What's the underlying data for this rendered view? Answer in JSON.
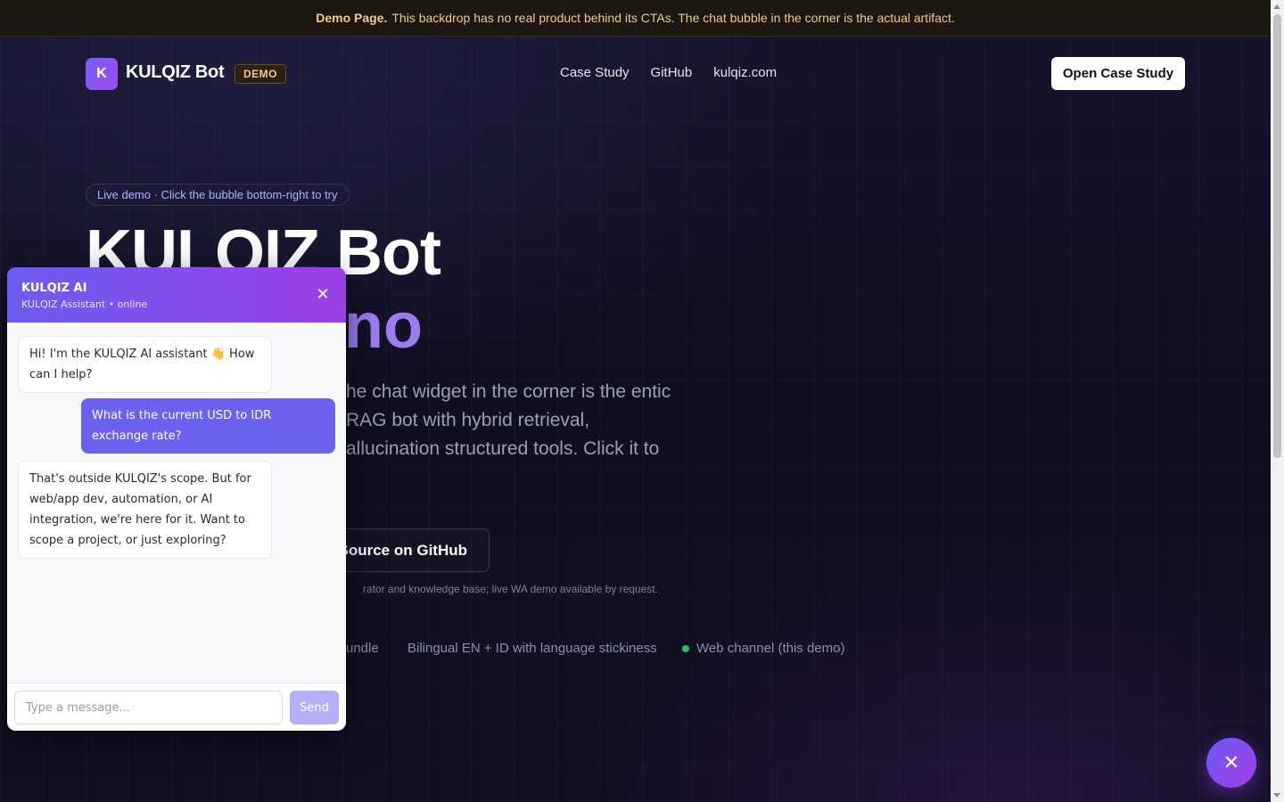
{
  "banner": {
    "strong": "Demo Page.",
    "text": "This backdrop has no real product behind its CTAs. The chat bubble in the corner is the actual artifact."
  },
  "nav": {
    "logo_letter": "K",
    "brand": "KULQIZ Bot",
    "badge": "DEMO",
    "links": [
      "Case Study",
      "GitHub",
      "kulqiz.com"
    ],
    "cta": "Open Case Study"
  },
  "hero": {
    "pill": "Live demo · Click the bubble bottom-right to try",
    "title_line1": "KULQIZ Bot",
    "title_line2": "no",
    "lead": "he chat widget in the corner is the entic RAG bot with hybrid retrieval, allucination structured tools. Click it to",
    "github_button": "Source on GitHub",
    "fine_print": "rator and knowledge base; live WA demo available by request.",
    "features": [
      "undle",
      "Bilingual EN + ID with language stickiness",
      "Web channel (this demo)"
    ]
  },
  "chat": {
    "title": "KULQIZ AI",
    "subtitle": "KULQIZ Assistant • online",
    "close_glyph": "✕",
    "messages": [
      {
        "role": "bot",
        "text": "Hi! I'm the KULQIZ AI assistant 👋 How can I help?"
      },
      {
        "role": "user",
        "text": "What is the current USD to IDR exchange rate?"
      },
      {
        "role": "bot",
        "text": "That's outside KULQIZ's scope. But for web/app dev, automation, or AI integration, we're here for it. Want to scope a project, or just exploring?"
      }
    ],
    "input_placeholder": "Type a message...",
    "send_label": "Send"
  },
  "launcher": {
    "glyph": "✕"
  },
  "colors": {
    "accent": "#6c5cf2",
    "accent2": "#9b40e8",
    "banner_text": "#f3c98b",
    "online_dot": "#22c55e"
  }
}
